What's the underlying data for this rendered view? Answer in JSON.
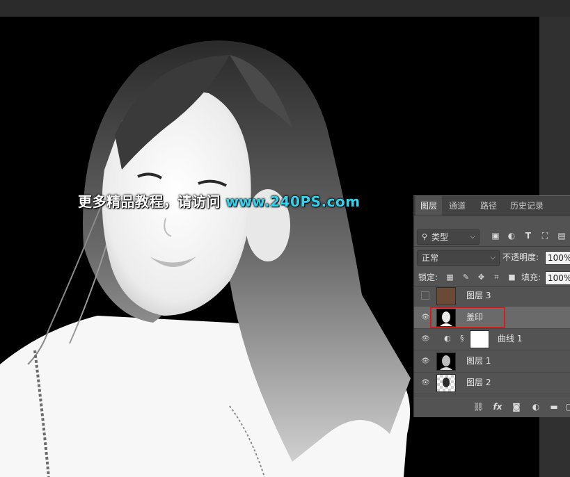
{
  "watermark": {
    "text": "更多精品教程，请访问",
    "url": "www.240PS.com"
  },
  "panel": {
    "tabs": [
      "图层",
      "通道",
      "路径",
      "历史记录"
    ],
    "active_tab": "图层",
    "filter": {
      "label": "类型",
      "icon": "search-icon"
    },
    "filter_icons": [
      "image-filter-icon",
      "adjustment-filter-icon",
      "type-filter-icon",
      "shape-filter-icon",
      "smart-object-filter-icon"
    ],
    "blend_mode": "正常",
    "opacity": {
      "label": "不透明度:",
      "value": "100%"
    },
    "lock": {
      "label": "锁定:",
      "icons": [
        "lock-pixels-icon",
        "lock-paint-icon",
        "lock-move-icon",
        "lock-artboard-icon",
        "lock-all-icon"
      ]
    },
    "fill": {
      "label": "填充:",
      "value": "100%"
    },
    "layers": [
      {
        "name": "图层 3",
        "visible": false,
        "thumb_color": "#6a4a34"
      },
      {
        "name": "盖印",
        "visible": true,
        "selected": true
      },
      {
        "name": "曲线 1",
        "visible": true,
        "adjustment": true
      },
      {
        "name": "图层 1",
        "visible": true
      },
      {
        "name": "图层 2",
        "visible": true
      }
    ],
    "bottom_icons": [
      "link-layers-icon",
      "fx-icon",
      "add-mask-icon",
      "new-adjustment-icon",
      "new-group-icon",
      "new-layer-icon"
    ],
    "fx_label": "fx"
  },
  "colors": {
    "highlight": "#d01e1e",
    "watermark_url": "#35d2f0",
    "panel_bg": "#535353"
  }
}
